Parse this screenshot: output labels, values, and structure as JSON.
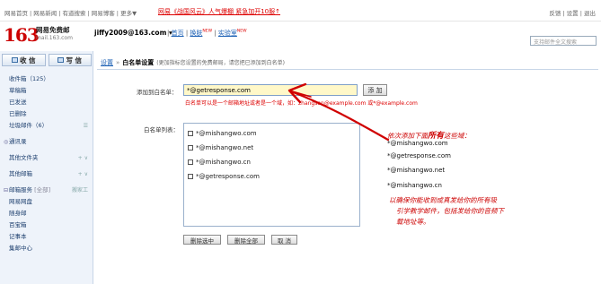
{
  "top_links": [
    "网易首页",
    "网易新闻",
    "有道搜索",
    "网易博客",
    "更多▼"
  ],
  "promo": "网易《战国风云》人气爆棚 紧急加开10服↑",
  "top_right": [
    "反馈",
    "设置",
    "退出"
  ],
  "brand": {
    "number": "163",
    "name": "网易免费邮",
    "domain": "mail.163.com"
  },
  "account": "jiffy2009@163.com ▾",
  "account_links": [
    {
      "label": "首页",
      "badge": ""
    },
    {
      "label": "换肤",
      "badge": "NEW"
    },
    {
      "label": "实验室",
      "badge": "NEW"
    }
  ],
  "search": {
    "placeholder": "支持邮件全文搜索"
  },
  "sidebar": {
    "receive": "收 信",
    "write": "写 信",
    "folders": [
      {
        "label": "收件箱（125）",
        "tail": ""
      },
      {
        "label": "草稿箱",
        "tail": ""
      },
      {
        "label": "已发送",
        "tail": ""
      },
      {
        "label": "已删除",
        "tail": ""
      },
      {
        "label": "垃圾邮件（6）",
        "tail": "☰"
      }
    ],
    "contacts": "通讯录",
    "other_folders": {
      "label": "其他文件夹",
      "tail": "+ ∨"
    },
    "other_mail": {
      "label": "其他邮箱",
      "tail": "+ ∨"
    },
    "services": {
      "label": "邮箱服务",
      "sub": "[全部]",
      "tail": "搬家工"
    },
    "service_items": [
      "网易网盘",
      "随身邮",
      "百宝箱",
      "记事本",
      "集邮中心"
    ]
  },
  "breadcrumb": {
    "settings": "设置",
    "sep": "»",
    "title": "白名单设置",
    "desc": "(更加指标您设置的免费邮局，请您把已添加到白名单)"
  },
  "form": {
    "add_label": "添加到白名单：",
    "add_value": "*@getresponse.com",
    "add_button": "添 加",
    "hint": "白名单可以是一个邮箱地址或者是一个域，如：zhangsan@example.com 或*@example.com",
    "list_label": "白名单列表：",
    "list_items": [
      "*@mishangwo.com",
      "*@mishangwo.net",
      "*@mishangwo.cn",
      "*@getresponse.com"
    ],
    "delete_selected": "删除选中",
    "delete_all": "删除全部",
    "cancel": "取 消"
  },
  "annotation": {
    "heading_pre": "依次添加下面",
    "heading_bold": "所有",
    "heading_post": "这些域：",
    "emails": [
      "*@mishangwo.com",
      "*@getresponse.com",
      "*@mishangwo.net",
      "*@mishangwo.cn"
    ],
    "note_line1": "以确保你能收到成真发给你的所有吸",
    "note_line2": "引学教学邮件，包括发给你的音频下",
    "note_line3": "载地址等。",
    "arrow_color": "#d00000"
  }
}
